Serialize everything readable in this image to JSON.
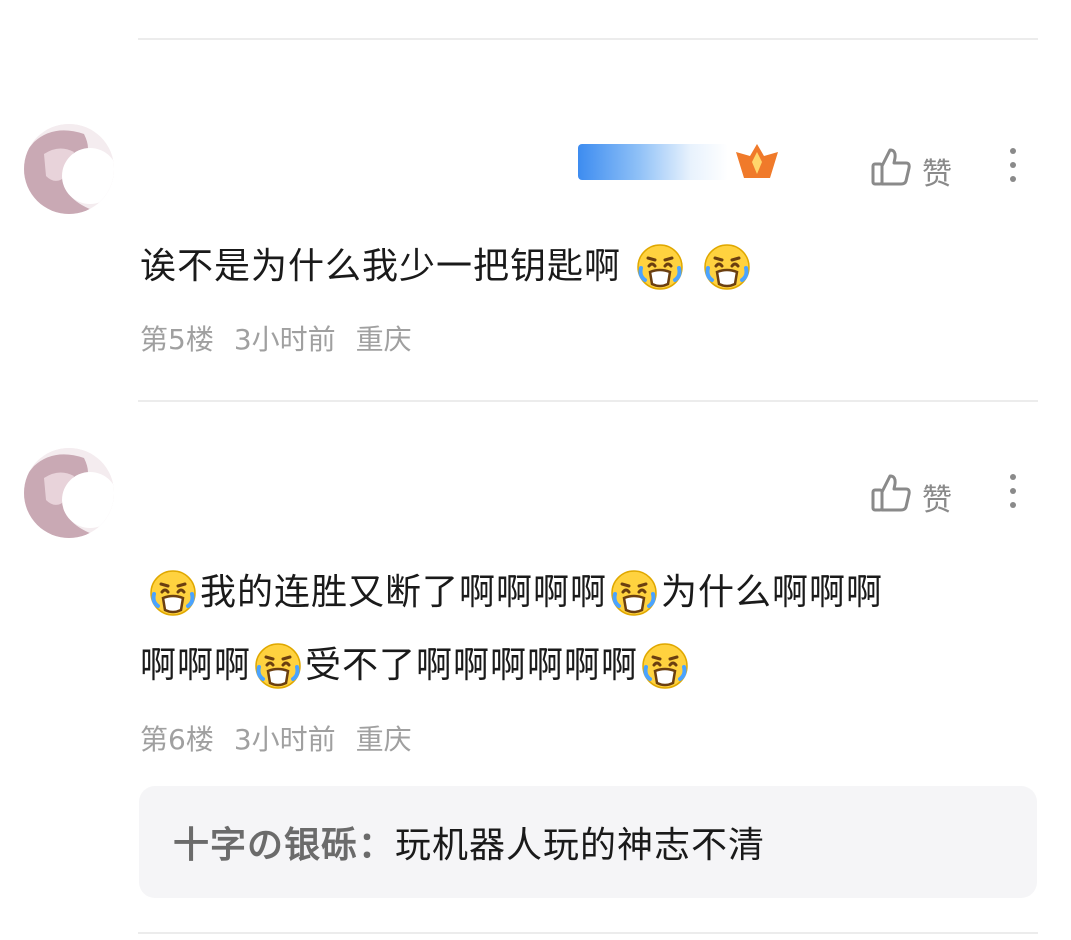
{
  "comments": [
    {
      "text": "诶不是为什么我少一把钥匙啊",
      "floor": "第5楼",
      "time": "3小时前",
      "location": "重庆",
      "like_label": "赞",
      "emojis": [
        "crying-face",
        "crying-face"
      ]
    },
    {
      "line1_a": "我的连胜又断了啊啊啊啊",
      "line1_b": "为什么啊啊啊",
      "line2_a": "啊啊啊",
      "line2_b": "受不了啊啊啊啊啊啊",
      "floor": "第6楼",
      "time": "3小时前",
      "location": "重庆",
      "like_label": "赞",
      "reply": {
        "author": "十字の银砾：",
        "text": "玩机器人玩的神志不清"
      }
    }
  ],
  "colors": {
    "text": "#1a1a1a",
    "meta": "#a0a0a0",
    "divider": "#ececec",
    "reply_bg": "#f5f5f7",
    "badge": "#3d8cf0"
  },
  "icons": {
    "like": "thumbs-up-icon",
    "more": "more-vertical-icon",
    "emoji": "crying-face-emoji",
    "badge": "level-badge-icon"
  }
}
